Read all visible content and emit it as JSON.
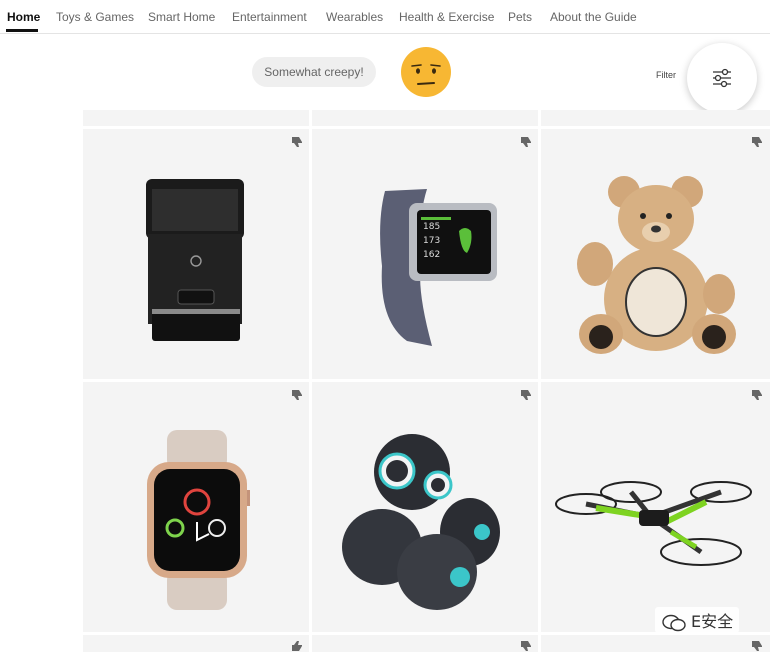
{
  "nav": {
    "items": [
      "Home",
      "Toys & Games",
      "Smart Home",
      "Entertainment",
      "Wearables",
      "Health & Exercise",
      "Pets",
      "About the Guide"
    ],
    "active": "Home"
  },
  "rating": {
    "label": "Somewhat creepy!",
    "face_icon": "worried-face-icon"
  },
  "filter": {
    "label": "Filter",
    "icon": "sliders-icon"
  },
  "products": [
    {
      "name": "pet-feeder"
    },
    {
      "name": "fitness-smartwatch"
    },
    {
      "name": "teddy-bear"
    },
    {
      "name": "apple-watch"
    },
    {
      "name": "toy-robot"
    },
    {
      "name": "camera-drone"
    }
  ],
  "watermark": {
    "text": "E安全"
  },
  "colors": {
    "accent": "#111111",
    "face": "#f7b733",
    "cell_bg": "#f4f4f4"
  }
}
